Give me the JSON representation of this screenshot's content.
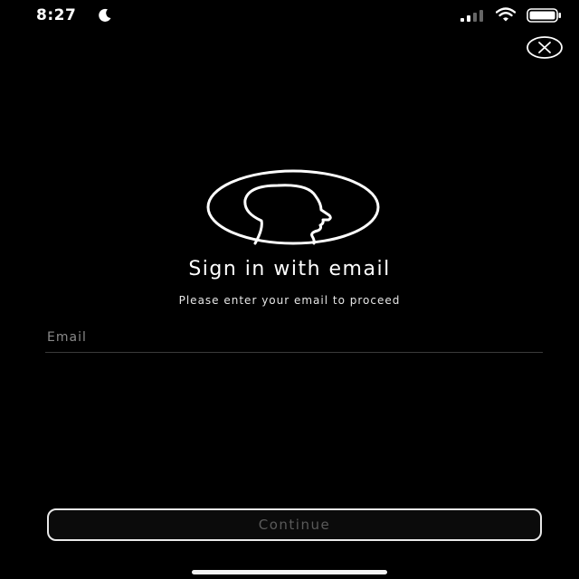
{
  "status_bar": {
    "time": "8:27",
    "icons": [
      "moon-icon",
      "cellular-signal-icon",
      "wifi-icon",
      "battery-icon"
    ]
  },
  "header": {
    "close_icon": "close-icon"
  },
  "main": {
    "avatar_icon": "person-silhouette-icon",
    "title": "Sign in with email",
    "subtitle": "Please enter your email to proceed",
    "email": {
      "placeholder": "Email",
      "value": ""
    },
    "continue_label": "Continue"
  },
  "colors": {
    "background": "#000000",
    "foreground": "#ffffff",
    "button_text_disabled": "#5a5a5a",
    "input_underline": "#3a3a3a"
  }
}
